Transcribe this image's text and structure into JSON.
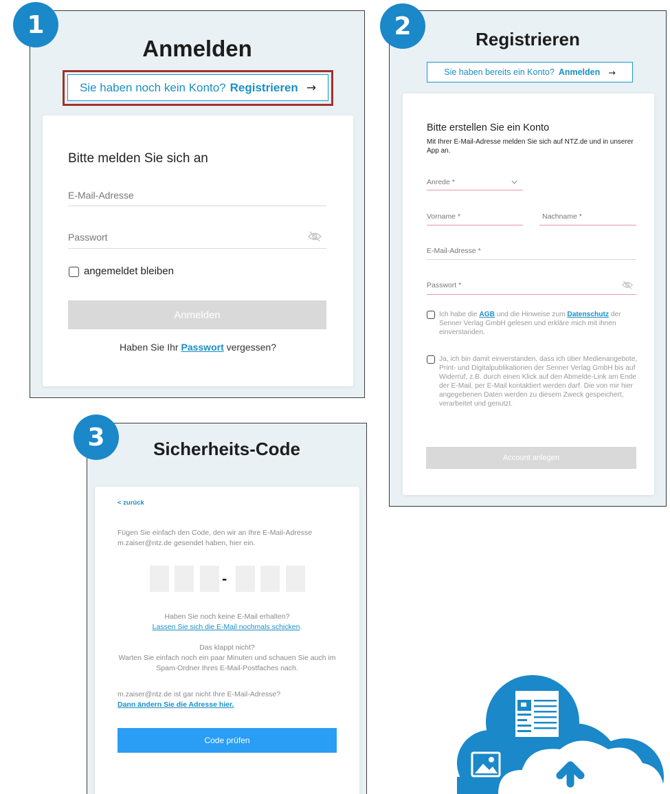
{
  "panel1": {
    "badge": "1",
    "title": "Anmelden",
    "register_prompt": "Sie haben noch kein Konto?",
    "register_link": "Registrieren",
    "arrow": "→",
    "heading": "Bitte melden Sie sich an",
    "email_placeholder": "E-Mail-Adresse",
    "password_placeholder": "Passwort",
    "remember_label": "angemeldet bleiben",
    "submit_label": "Anmelden",
    "forgot_prefix": "Haben Sie Ihr",
    "forgot_link": "Passwort",
    "forgot_suffix": "vergessen?"
  },
  "panel2": {
    "badge": "2",
    "title": "Registrieren",
    "login_prompt": "Sie haben bereits ein Konto?",
    "login_link": "Anmelden",
    "arrow": "→",
    "heading": "Bitte erstellen Sie ein Konto",
    "subheading": "Mit Ihrer E-Mail-Adresse melden Sie sich auf NTZ.de und in unserer App an.",
    "salutation": "Anrede *",
    "first_name": "Vorname *",
    "last_name": "Nachname *",
    "email": "E-Mail-Adresse *",
    "password": "Passwort *",
    "terms_pre": "Ich habe die",
    "terms_agb": "AGB",
    "terms_mid": "und die Hinweise zum",
    "terms_privacy": "Datenschutz",
    "terms_post": "der Senner Verlag GmbH gelesen und erkläre mich mit ihnen einverstanden.",
    "consent": "Ja, ich bin damit einverstanden, dass ich über Medienangebote, Print- und Digitalpublikationen der Senner Verlag GmbH bis auf Widerruf, z.B. durch einen Klick auf den Abmelde-Link am Ende der E-Mail, per E-Mail kontaktiert werden darf. Die von mir hier angegebenen Daten werden zu diesem Zweck gespeichert, verarbeitet und genutzt.",
    "submit_label": "Account anlegen"
  },
  "panel3": {
    "badge": "3",
    "title": "Sicherheits-Code",
    "back_link": "< zurück",
    "instruction": "Fügen Sie einfach den Code, den wir an Ihre E-Mail-Adresse m.zaiser@ntz.de gesendet haben, hier ein.",
    "dash": "-",
    "no_email_q": "Haben Sie noch keine E-Mail erhalten?",
    "resend_link": "Lassen Sie sich die E-Mail nochmals schicken",
    "resend_period": ".",
    "not_working": "Das klappt nicht?",
    "wait_text": "Warten Sie einfach noch ein paar Minuten und schauen Sie auch im Spam-Ordner Ihres E-Mail-Postfaches nach.",
    "wrong_email": "m.zaiser@ntz.de ist gar nicht Ihre E-Mail-Adresse?",
    "change_link": "Dann ändern Sie die Adresse hier.",
    "submit_label": "Code prüfen"
  },
  "colors": {
    "accent": "#1a88c9",
    "link": "#1a8fc6",
    "button_blue": "#2a9df4",
    "highlight_red": "#a3302d",
    "panel_bg": "#e9f1f4"
  },
  "icons": [
    "eye-off-icon",
    "cloud-upload-icon",
    "image-icon",
    "newspaper-icon"
  ]
}
